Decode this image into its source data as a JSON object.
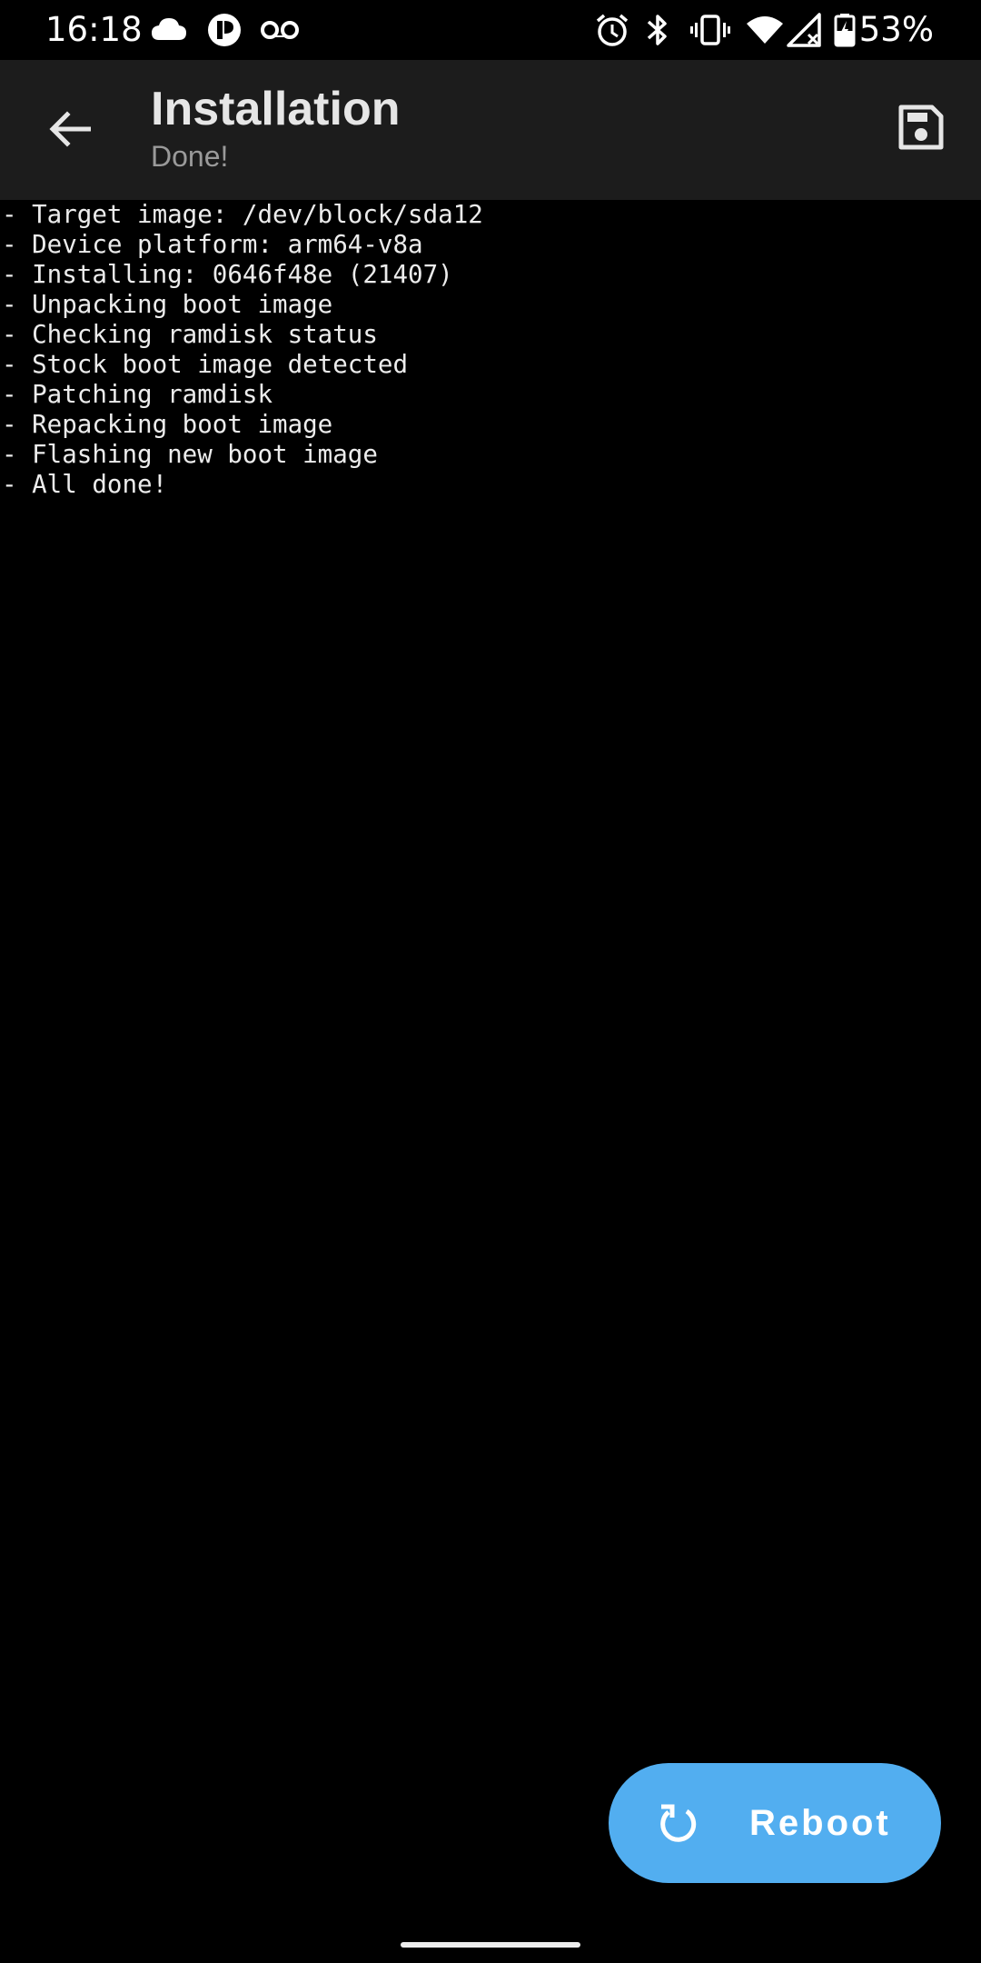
{
  "status_bar": {
    "time": "16:18",
    "battery_percent": "53%",
    "icons_left": [
      "cloud-icon",
      "app-notification-icon",
      "voicemail-icon"
    ],
    "icons_right": [
      "alarm-icon",
      "bluetooth-icon",
      "vibrate-icon",
      "wifi-icon",
      "cellular-no-data-icon",
      "battery-charging-icon"
    ]
  },
  "toolbar": {
    "back_icon": "arrow-left-icon",
    "title": "Installation",
    "subtitle": "Done!",
    "save_icon": "save-icon"
  },
  "log": {
    "lines": [
      "- Target image: /dev/block/sda12",
      "- Device platform: arm64-v8a",
      "- Installing: 0646f48e (21407)",
      "- Unpacking boot image",
      "- Checking ramdisk status",
      "- Stock boot image detected",
      "- Patching ramdisk",
      "- Repacking boot image",
      "- Flashing new boot image",
      "- All done!"
    ]
  },
  "fab": {
    "icon": "restart-icon",
    "label": "Reboot"
  },
  "colors": {
    "background": "#000000",
    "toolbar": "#1c1c1c",
    "fab": "#52aef0",
    "title_text": "#e6e6e6",
    "subtitle_text": "#9a9a9a",
    "log_text": "#ececec"
  }
}
